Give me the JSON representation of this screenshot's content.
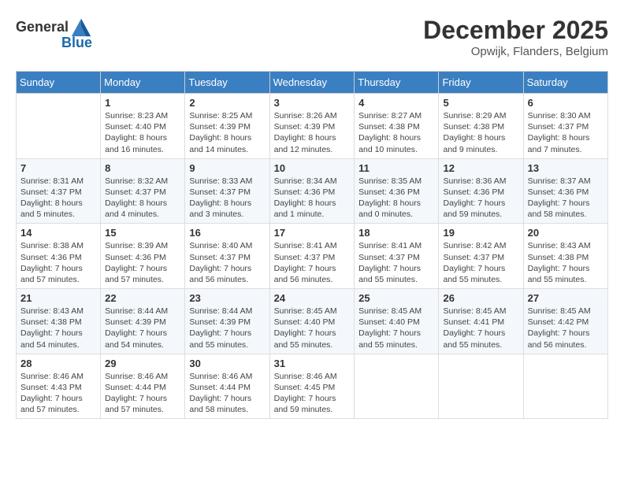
{
  "header": {
    "logo_general": "General",
    "logo_blue": "Blue",
    "month_year": "December 2025",
    "location": "Opwijk, Flanders, Belgium"
  },
  "days_of_week": [
    "Sunday",
    "Monday",
    "Tuesday",
    "Wednesday",
    "Thursday",
    "Friday",
    "Saturday"
  ],
  "weeks": [
    [
      {
        "day": "",
        "info": ""
      },
      {
        "day": "1",
        "info": "Sunrise: 8:23 AM\nSunset: 4:40 PM\nDaylight: 8 hours\nand 16 minutes."
      },
      {
        "day": "2",
        "info": "Sunrise: 8:25 AM\nSunset: 4:39 PM\nDaylight: 8 hours\nand 14 minutes."
      },
      {
        "day": "3",
        "info": "Sunrise: 8:26 AM\nSunset: 4:39 PM\nDaylight: 8 hours\nand 12 minutes."
      },
      {
        "day": "4",
        "info": "Sunrise: 8:27 AM\nSunset: 4:38 PM\nDaylight: 8 hours\nand 10 minutes."
      },
      {
        "day": "5",
        "info": "Sunrise: 8:29 AM\nSunset: 4:38 PM\nDaylight: 8 hours\nand 9 minutes."
      },
      {
        "day": "6",
        "info": "Sunrise: 8:30 AM\nSunset: 4:37 PM\nDaylight: 8 hours\nand 7 minutes."
      }
    ],
    [
      {
        "day": "7",
        "info": "Sunrise: 8:31 AM\nSunset: 4:37 PM\nDaylight: 8 hours\nand 5 minutes."
      },
      {
        "day": "8",
        "info": "Sunrise: 8:32 AM\nSunset: 4:37 PM\nDaylight: 8 hours\nand 4 minutes."
      },
      {
        "day": "9",
        "info": "Sunrise: 8:33 AM\nSunset: 4:37 PM\nDaylight: 8 hours\nand 3 minutes."
      },
      {
        "day": "10",
        "info": "Sunrise: 8:34 AM\nSunset: 4:36 PM\nDaylight: 8 hours\nand 1 minute."
      },
      {
        "day": "11",
        "info": "Sunrise: 8:35 AM\nSunset: 4:36 PM\nDaylight: 8 hours\nand 0 minutes."
      },
      {
        "day": "12",
        "info": "Sunrise: 8:36 AM\nSunset: 4:36 PM\nDaylight: 7 hours\nand 59 minutes."
      },
      {
        "day": "13",
        "info": "Sunrise: 8:37 AM\nSunset: 4:36 PM\nDaylight: 7 hours\nand 58 minutes."
      }
    ],
    [
      {
        "day": "14",
        "info": "Sunrise: 8:38 AM\nSunset: 4:36 PM\nDaylight: 7 hours\nand 57 minutes."
      },
      {
        "day": "15",
        "info": "Sunrise: 8:39 AM\nSunset: 4:36 PM\nDaylight: 7 hours\nand 57 minutes."
      },
      {
        "day": "16",
        "info": "Sunrise: 8:40 AM\nSunset: 4:37 PM\nDaylight: 7 hours\nand 56 minutes."
      },
      {
        "day": "17",
        "info": "Sunrise: 8:41 AM\nSunset: 4:37 PM\nDaylight: 7 hours\nand 56 minutes."
      },
      {
        "day": "18",
        "info": "Sunrise: 8:41 AM\nSunset: 4:37 PM\nDaylight: 7 hours\nand 55 minutes."
      },
      {
        "day": "19",
        "info": "Sunrise: 8:42 AM\nSunset: 4:37 PM\nDaylight: 7 hours\nand 55 minutes."
      },
      {
        "day": "20",
        "info": "Sunrise: 8:43 AM\nSunset: 4:38 PM\nDaylight: 7 hours\nand 55 minutes."
      }
    ],
    [
      {
        "day": "21",
        "info": "Sunrise: 8:43 AM\nSunset: 4:38 PM\nDaylight: 7 hours\nand 54 minutes."
      },
      {
        "day": "22",
        "info": "Sunrise: 8:44 AM\nSunset: 4:39 PM\nDaylight: 7 hours\nand 54 minutes."
      },
      {
        "day": "23",
        "info": "Sunrise: 8:44 AM\nSunset: 4:39 PM\nDaylight: 7 hours\nand 55 minutes."
      },
      {
        "day": "24",
        "info": "Sunrise: 8:45 AM\nSunset: 4:40 PM\nDaylight: 7 hours\nand 55 minutes."
      },
      {
        "day": "25",
        "info": "Sunrise: 8:45 AM\nSunset: 4:40 PM\nDaylight: 7 hours\nand 55 minutes."
      },
      {
        "day": "26",
        "info": "Sunrise: 8:45 AM\nSunset: 4:41 PM\nDaylight: 7 hours\nand 55 minutes."
      },
      {
        "day": "27",
        "info": "Sunrise: 8:45 AM\nSunset: 4:42 PM\nDaylight: 7 hours\nand 56 minutes."
      }
    ],
    [
      {
        "day": "28",
        "info": "Sunrise: 8:46 AM\nSunset: 4:43 PM\nDaylight: 7 hours\nand 57 minutes."
      },
      {
        "day": "29",
        "info": "Sunrise: 8:46 AM\nSunset: 4:44 PM\nDaylight: 7 hours\nand 57 minutes."
      },
      {
        "day": "30",
        "info": "Sunrise: 8:46 AM\nSunset: 4:44 PM\nDaylight: 7 hours\nand 58 minutes."
      },
      {
        "day": "31",
        "info": "Sunrise: 8:46 AM\nSunset: 4:45 PM\nDaylight: 7 hours\nand 59 minutes."
      },
      {
        "day": "",
        "info": ""
      },
      {
        "day": "",
        "info": ""
      },
      {
        "day": "",
        "info": ""
      }
    ]
  ]
}
